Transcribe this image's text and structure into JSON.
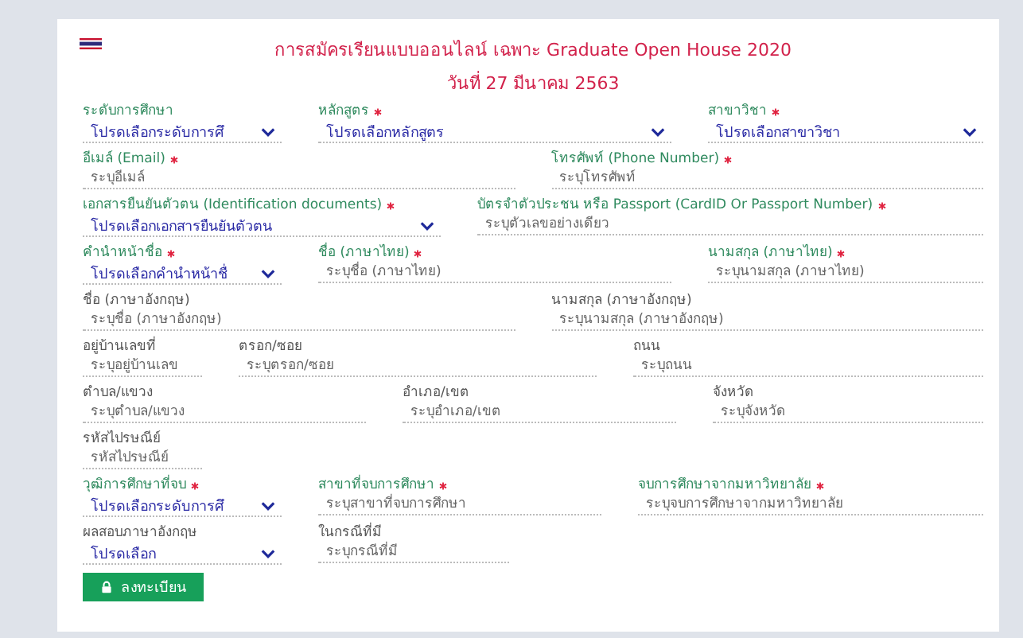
{
  "title": "การสมัครเรียนแบบออนไลน์ เฉพาะ Graduate Open House 2020",
  "date": "วันที่ 27 มีนาคม 2563",
  "rows": [
    [
      {
        "label": "ระดับการศึกษา",
        "required": false,
        "highlighted": true,
        "kind": "select",
        "value": "โปรดเลือกระดับการศึ"
      },
      {
        "label": "หลักสูตร",
        "required": true,
        "highlighted": true,
        "kind": "select",
        "value": "โปรดเลือกหลักสูตร"
      },
      {
        "label": "สาขาวิชา",
        "required": true,
        "highlighted": true,
        "kind": "select",
        "value": "โปรดเลือกสาขาวิชา"
      }
    ],
    [
      {
        "label": "อีเมล์ (Email)",
        "required": true,
        "highlighted": true,
        "kind": "input",
        "placeholder": "ระบุอีเมล์"
      },
      {
        "label": "โทรศัพท์ (Phone Number)",
        "required": true,
        "highlighted": true,
        "kind": "input",
        "placeholder": "ระบุโทรศัพท์"
      }
    ],
    [
      {
        "label": "เอกสารยืนยันตัวตน (Identification documents)",
        "required": true,
        "highlighted": true,
        "kind": "select",
        "value": "โปรดเลือกเอกสารยืนยันตัวตน"
      },
      {
        "label": "บัตรจำตัวประชน หรือ Passport (CardID Or Passport Number)",
        "required": true,
        "highlighted": true,
        "kind": "input",
        "placeholder": "ระบุตัวเลขอย่างเดียว"
      }
    ],
    [
      {
        "label": "คำนำหน้าชื่อ",
        "required": true,
        "highlighted": true,
        "kind": "select",
        "value": "โปรดเลือกคำนำหน้าชื่"
      },
      {
        "label": "ชื่อ (ภาษาไทย)",
        "required": true,
        "highlighted": true,
        "kind": "input",
        "placeholder": "ระบุชื่อ (ภาษาไทย)"
      },
      {
        "label": "นามสกุล (ภาษาไทย)",
        "required": true,
        "highlighted": true,
        "kind": "input",
        "placeholder": "ระบุนามสกุล (ภาษาไทย)"
      }
    ],
    [
      {
        "label": "ชื่อ (ภาษาอังกฤษ)",
        "required": false,
        "highlighted": false,
        "kind": "input",
        "placeholder": "ระบุชื่อ (ภาษาอังกฤษ)"
      },
      {
        "label": "นามสกุล (ภาษาอังกฤษ)",
        "required": false,
        "highlighted": false,
        "kind": "input",
        "placeholder": "ระบุนามสกุล (ภาษาอังกฤษ)"
      }
    ],
    [
      {
        "label": "อยู่บ้านเลขที่",
        "required": false,
        "highlighted": false,
        "kind": "input",
        "placeholder": "ระบุอยู่บ้านเลข"
      },
      {
        "label": "ตรอก/ซอย",
        "required": false,
        "highlighted": false,
        "kind": "input",
        "placeholder": "ระบุตรอก/ซอย"
      },
      {
        "label": "ถนน",
        "required": false,
        "highlighted": false,
        "kind": "input",
        "placeholder": "ระบุถนน"
      }
    ],
    [
      {
        "label": "ตำบล/แขวง",
        "required": false,
        "highlighted": false,
        "kind": "input",
        "placeholder": "ระบุตำบล/แขวง"
      },
      {
        "label": "อำเภอ/เขต",
        "required": false,
        "highlighted": false,
        "kind": "input",
        "placeholder": "ระบุอำเภอ/เขต"
      },
      {
        "label": "จังหวัด",
        "required": false,
        "highlighted": false,
        "kind": "input",
        "placeholder": "ระบุจังหวัด"
      }
    ],
    [
      {
        "label": "รหัสไปรษณีย์",
        "required": false,
        "highlighted": false,
        "kind": "input",
        "placeholder": "รหัสไปรษณีย์"
      }
    ],
    [
      {
        "label": "วุฒิการศึกษาที่จบ",
        "required": true,
        "highlighted": true,
        "kind": "select",
        "value": "โปรดเลือกระดับการศึ"
      },
      {
        "label": "สาขาที่จบการศึกษา",
        "required": true,
        "highlighted": true,
        "kind": "input",
        "placeholder": "ระบุสาขาที่จบการศึกษา"
      },
      {
        "label": "จบการศึกษาจากมหาวิทยาลัย",
        "required": true,
        "highlighted": true,
        "kind": "input",
        "placeholder": "ระบุจบการศึกษาจากมหาวิทยาลัย"
      }
    ],
    [
      {
        "label": "ผลสอบภาษาอังกฤษ",
        "required": false,
        "highlighted": false,
        "kind": "select",
        "value": "โปรดเลือก"
      },
      {
        "label": "ในกรณีที่มี",
        "required": false,
        "highlighted": false,
        "kind": "input",
        "placeholder": "ระบุกรณีที่มี"
      }
    ]
  ],
  "submit": "ลงทะเบียน"
}
